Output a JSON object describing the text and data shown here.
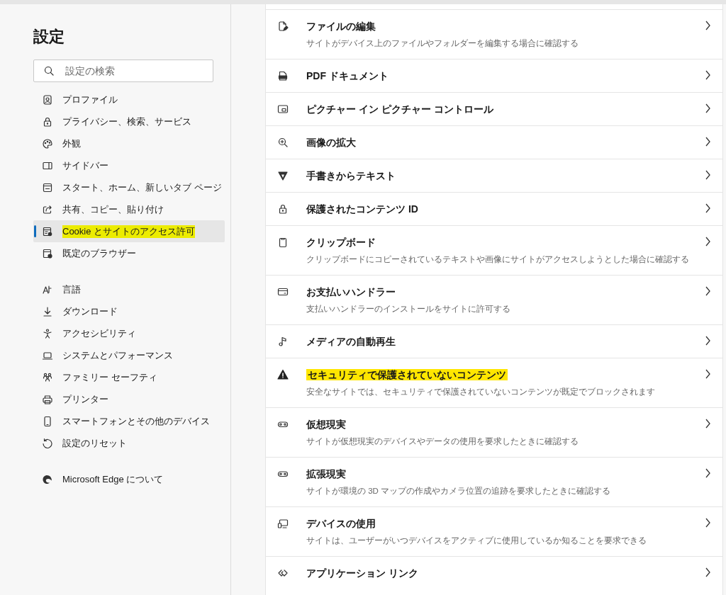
{
  "sidebar": {
    "title": "設定",
    "search": {
      "placeholder": "設定の検索"
    },
    "groups": [
      [
        {
          "label": "プロファイル",
          "selected": false,
          "highlighted": false
        },
        {
          "label": "プライバシー、検索、サービス",
          "selected": false,
          "highlighted": false
        },
        {
          "label": "外観",
          "selected": false,
          "highlighted": false
        },
        {
          "label": "サイドバー",
          "selected": false,
          "highlighted": false
        },
        {
          "label": "スタート、ホーム、新しいタブ ページ",
          "selected": false,
          "highlighted": false
        },
        {
          "label": "共有、コピー、貼り付け",
          "selected": false,
          "highlighted": false
        },
        {
          "label": "Cookie とサイトのアクセス許可",
          "selected": true,
          "highlighted": true
        },
        {
          "label": "既定のブラウザー",
          "selected": false,
          "highlighted": false
        }
      ],
      [
        {
          "label": "言語",
          "selected": false,
          "highlighted": false
        },
        {
          "label": "ダウンロード",
          "selected": false,
          "highlighted": false
        },
        {
          "label": "アクセシビリティ",
          "selected": false,
          "highlighted": false
        },
        {
          "label": "システムとパフォーマンス",
          "selected": false,
          "highlighted": false
        },
        {
          "label": "ファミリー セーフティ",
          "selected": false,
          "highlighted": false
        },
        {
          "label": "プリンター",
          "selected": false,
          "highlighted": false
        },
        {
          "label": "スマートフォンとその他のデバイス",
          "selected": false,
          "highlighted": false
        },
        {
          "label": "設定のリセット",
          "selected": false,
          "highlighted": false
        }
      ],
      [
        {
          "label": "Microsoft Edge について",
          "selected": false,
          "highlighted": false
        }
      ]
    ]
  },
  "permissions": [
    {
      "title": "ファイルの編集",
      "description": "サイトがデバイス上のファイルやフォルダーを編集する場合に確認する",
      "highlighted": false
    },
    {
      "title": "PDF ドキュメント",
      "highlighted": false
    },
    {
      "title": "ピクチャー イン ピクチャー コントロール",
      "highlighted": false
    },
    {
      "title": "画像の拡大",
      "highlighted": false
    },
    {
      "title": "手書きからテキスト",
      "highlighted": false
    },
    {
      "title": "保護されたコンテンツ ID",
      "highlighted": false
    },
    {
      "title": "クリップボード",
      "description": "クリップボードにコピーされているテキストや画像にサイトがアクセスしようとした場合に確認する",
      "highlighted": false
    },
    {
      "title": "お支払いハンドラー",
      "description": "支払いハンドラーのインストールをサイトに許可する",
      "highlighted": false
    },
    {
      "title": "メディアの自動再生",
      "highlighted": false
    },
    {
      "title": "セキュリティで保護されていないコンテンツ",
      "description": "安全なサイトでは、セキュリティで保護されていないコンテンツが既定でブロックされます",
      "highlighted": true
    },
    {
      "title": "仮想現実",
      "description": "サイトが仮想現実のデバイスやデータの使用を要求したときに確認する",
      "highlighted": false
    },
    {
      "title": "拡張現実",
      "description": "サイトが環境の 3D マップの作成やカメラ位置の追跡を要求したときに確認する",
      "highlighted": false
    },
    {
      "title": "デバイスの使用",
      "description": "サイトは、ユーザーがいつデバイスをアクティブに使用しているか知ることを要求できる",
      "highlighted": false
    },
    {
      "title": "アプリケーション リンク",
      "highlighted": false
    }
  ]
}
